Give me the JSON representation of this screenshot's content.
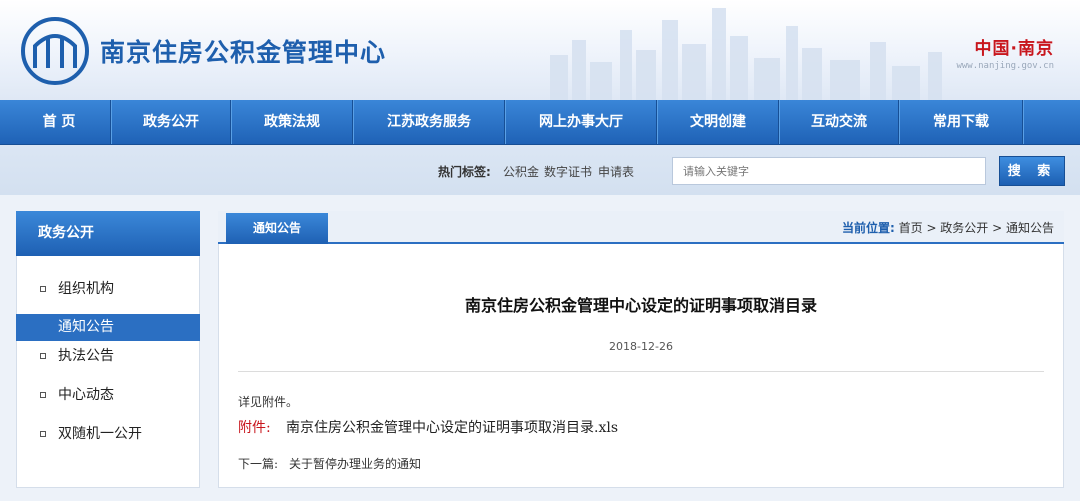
{
  "header": {
    "site_title": "南京住房公积金管理中心",
    "brand_main": "中国·南京",
    "brand_sub": "www.nanjing.gov.cn"
  },
  "nav": {
    "items": [
      {
        "label": "首 页"
      },
      {
        "label": "政务公开"
      },
      {
        "label": "政策法规"
      },
      {
        "label": "江苏政务服务"
      },
      {
        "label": "网上办事大厅"
      },
      {
        "label": "文明创建"
      },
      {
        "label": "互动交流"
      },
      {
        "label": "常用下载"
      }
    ]
  },
  "search": {
    "hot_label": "热门标签:",
    "hot_tags": [
      "公积金",
      "数字证书",
      "申请表"
    ],
    "placeholder": "请输入关键字",
    "button_label": "搜 索"
  },
  "sidebar": {
    "heading": "政务公开",
    "items": [
      {
        "label": "组织机构",
        "active": false
      },
      {
        "label": "通知公告",
        "active": true
      },
      {
        "label": "执法公告",
        "active": false
      },
      {
        "label": "中心动态",
        "active": false
      },
      {
        "label": "双随机一公开",
        "active": false
      }
    ]
  },
  "main": {
    "tab_label": "通知公告",
    "breadcrumb": {
      "prefix": "当前位置:",
      "path": "首页 > 政务公开 > 通知公告"
    },
    "article": {
      "title": "南京住房公积金管理中心设定的证明事项取消目录",
      "date": "2018-12-26",
      "body": "详见附件。",
      "attachment_label": "附件:",
      "attachment_name": "南京住房公积金管理中心设定的证明事项取消目录.xls",
      "next_label": "下一篇:",
      "next_title": "关于暂停办理业务的通知"
    }
  },
  "colors": {
    "primary": "#1f62b6",
    "accent_red": "#c8161d",
    "page_bg": "#edf2f9"
  }
}
